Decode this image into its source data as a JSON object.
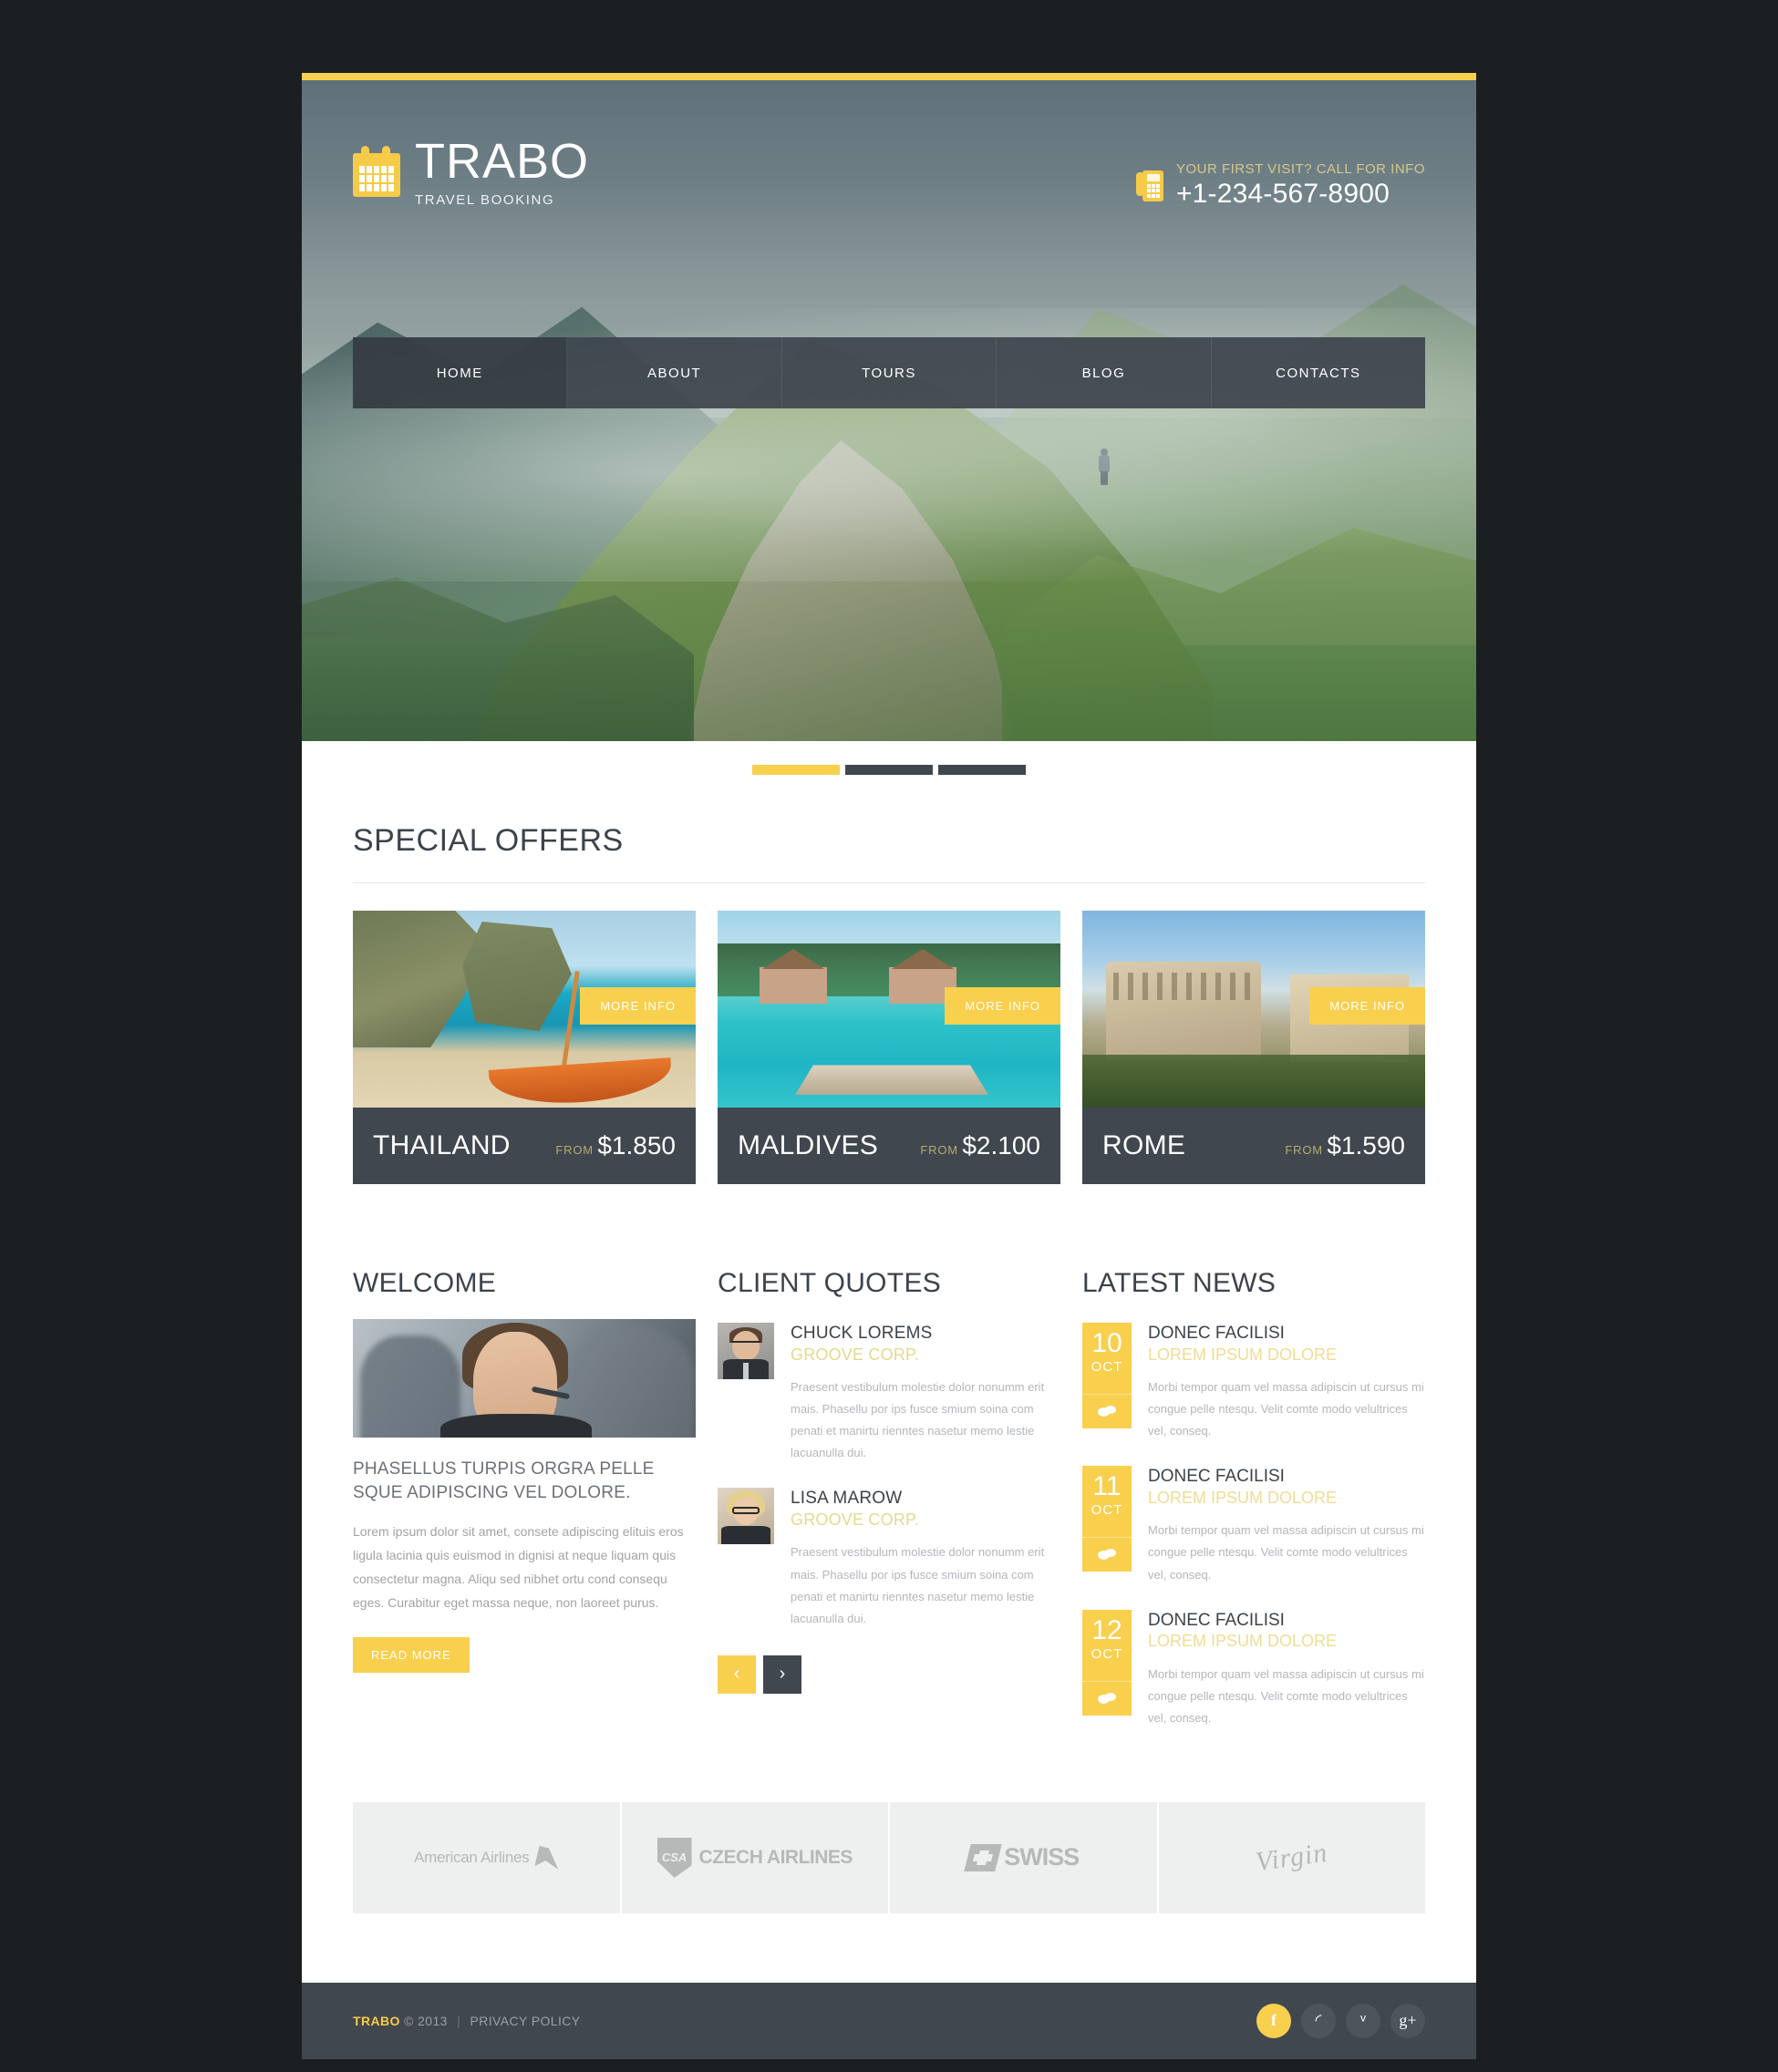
{
  "brand": {
    "name": "TRABO",
    "tagline": "TRAVEL BOOKING",
    "logo_icon": "calendar-icon",
    "accent_color": "#f9cf4e",
    "dark_color": "#40474f"
  },
  "header": {
    "phone_icon": "telephone-icon",
    "call_label": "YOUR FIRST VISIT? CALL FOR INFO",
    "phone_number": "+1-234-567-8900"
  },
  "nav": {
    "items": [
      {
        "label": "HOME",
        "active": true
      },
      {
        "label": "ABOUT",
        "active": false
      },
      {
        "label": "TOURS",
        "active": false
      },
      {
        "label": "BLOG",
        "active": false
      },
      {
        "label": "CONTACTS",
        "active": false
      }
    ]
  },
  "slider": {
    "slides": 3,
    "active_index": 0
  },
  "offers": {
    "title": "SPECIAL OFFERS",
    "from_label": "FROM",
    "more_label": "MORE INFO",
    "items": [
      {
        "name": "THAILAND",
        "from": "FROM",
        "price": "$1.850",
        "more": "MORE INFO"
      },
      {
        "name": "MALDIVES",
        "from": "FROM",
        "price": "$2.100",
        "more": "MORE INFO"
      },
      {
        "name": "ROME",
        "from": "FROM",
        "price": "$1.590",
        "more": "MORE INFO"
      }
    ]
  },
  "welcome": {
    "title": "WELCOME",
    "heading": "PHASELLUS TURPIS ORGRA PELLE SQUE ADIPISCING VEL DOLORE.",
    "body": "Lorem ipsum dolor sit amet, consete adipiscing elituis eros ligula lacinia quis euismod in dignisi at neque liquam quis consectetur magna. Aliqu sed nibhet ortu cond consequ eges. Curabitur eget massa neque, non laoreet purus.",
    "button": "READ MORE"
  },
  "quotes": {
    "title": "CLIENT QUOTES",
    "items": [
      {
        "name": "CHUCK LOREMS",
        "company": "GROOVE CORP.",
        "text": "Praesent vestibulum molestie dolor nonumm erit mais. Phasellu por ips fusce smium soina com penati et manirtu rienntes nasetur memo lestie lacuanulla dui.",
        "avatar": "avatar-male"
      },
      {
        "name": "LISA MAROW",
        "company": "GROOVE CORP.",
        "text": "Praesent vestibulum molestie dolor nonumm erit mais. Phasellu por ips fusce smium soina com penati et manirtu rienntes nasetur memo lestie lacuanulla dui.",
        "avatar": "avatar-female"
      }
    ],
    "prev_icon": "chevron-left-icon",
    "next_icon": "chevron-right-icon"
  },
  "news": {
    "title": "LATEST NEWS",
    "items": [
      {
        "day": "10",
        "month": "OCT",
        "title": "DONEC FACILISI",
        "subtitle": "LOREM IPSUM DOLORE",
        "text": "Morbi tempor quam vel massa adipiscin ut cursus mi congue pelle ntesqu. Velit comte modo velultrices vel, conseq.",
        "comment_icon": "comment-bubble-icon"
      },
      {
        "day": "11",
        "month": "OCT",
        "title": "DONEC FACILISI",
        "subtitle": "LOREM IPSUM DOLORE",
        "text": "Morbi tempor quam vel massa adipiscin ut cursus mi congue pelle ntesqu. Velit comte modo velultrices vel, conseq.",
        "comment_icon": "comment-bubble-icon"
      },
      {
        "day": "12",
        "month": "OCT",
        "title": "DONEC FACILISI",
        "subtitle": "LOREM IPSUM DOLORE",
        "text": "Morbi tempor quam vel massa adipiscin ut cursus mi congue pelle ntesqu. Velit comte modo velultrices vel, conseq.",
        "comment_icon": "comment-bubble-icon"
      }
    ]
  },
  "partners": {
    "items": [
      {
        "name": "American Airlines",
        "icon": "american-airlines-logo"
      },
      {
        "name": "CZECH AIRLINES",
        "mark": "CSA",
        "icon": "czech-airlines-logo"
      },
      {
        "name": "SWISS",
        "icon": "swiss-airlines-logo"
      },
      {
        "name": "Virgin",
        "icon": "virgin-logo"
      }
    ]
  },
  "footer": {
    "brand": "TRABO",
    "copyright": "© 2013",
    "separator": "|",
    "privacy": "PRIVACY POLICY",
    "social": [
      {
        "name": "facebook",
        "glyph": "f",
        "active": true
      },
      {
        "name": "rss",
        "glyph": "◜",
        "active": false
      },
      {
        "name": "twitter",
        "glyph": "ᵛ",
        "active": false
      },
      {
        "name": "google-plus",
        "glyph": "g+",
        "active": false
      }
    ]
  }
}
